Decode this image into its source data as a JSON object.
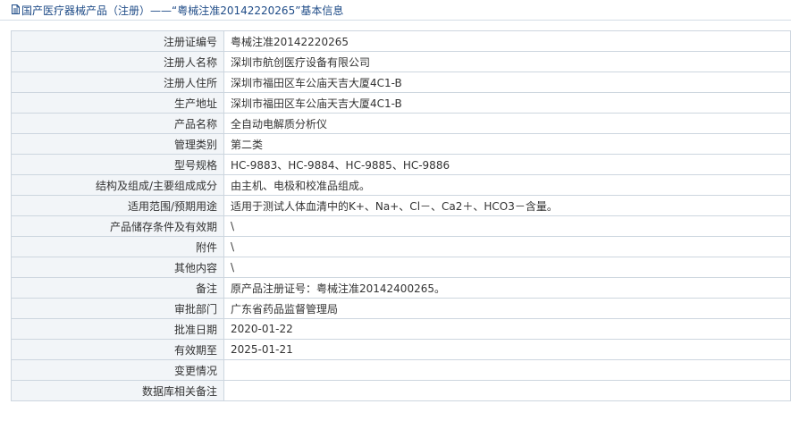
{
  "header": {
    "title": "国产医疗器械产品（注册）——“粤械注准20142220265”基本信息",
    "icon": "document-icon"
  },
  "rows": [
    {
      "label": "注册证编号",
      "value": "粤械注准20142220265"
    },
    {
      "label": "注册人名称",
      "value": "深圳市航创医疗设备有限公司"
    },
    {
      "label": "注册人住所",
      "value": "深圳市福田区车公庙天吉大厦4C1-B"
    },
    {
      "label": "生产地址",
      "value": "深圳市福田区车公庙天吉大厦4C1-B"
    },
    {
      "label": "产品名称",
      "value": "全自动电解质分析仪"
    },
    {
      "label": "管理类别",
      "value": "第二类"
    },
    {
      "label": "型号规格",
      "value": "HC-9883、HC-9884、HC-9885、HC-9886"
    },
    {
      "label": "结构及组成/主要组成成分",
      "value": "由主机、电极和校准品组成。"
    },
    {
      "label": "适用范围/预期用途",
      "value": "适用于测试人体血清中的K+、Na+、Cl－、Ca2＋、HCO3－含量。"
    },
    {
      "label": "产品储存条件及有效期",
      "value": "\\"
    },
    {
      "label": "附件",
      "value": "\\"
    },
    {
      "label": "其他内容",
      "value": "\\"
    },
    {
      "label": "备注",
      "value": "原产品注册证号：粤械注准20142400265。"
    },
    {
      "label": "审批部门",
      "value": "广东省药品监督管理局"
    },
    {
      "label": "批准日期",
      "value": "2020-01-22"
    },
    {
      "label": "有效期至",
      "value": "2025-01-21"
    },
    {
      "label": "变更情况",
      "value": ""
    },
    {
      "label": "数据库相关备注",
      "value": ""
    }
  ]
}
